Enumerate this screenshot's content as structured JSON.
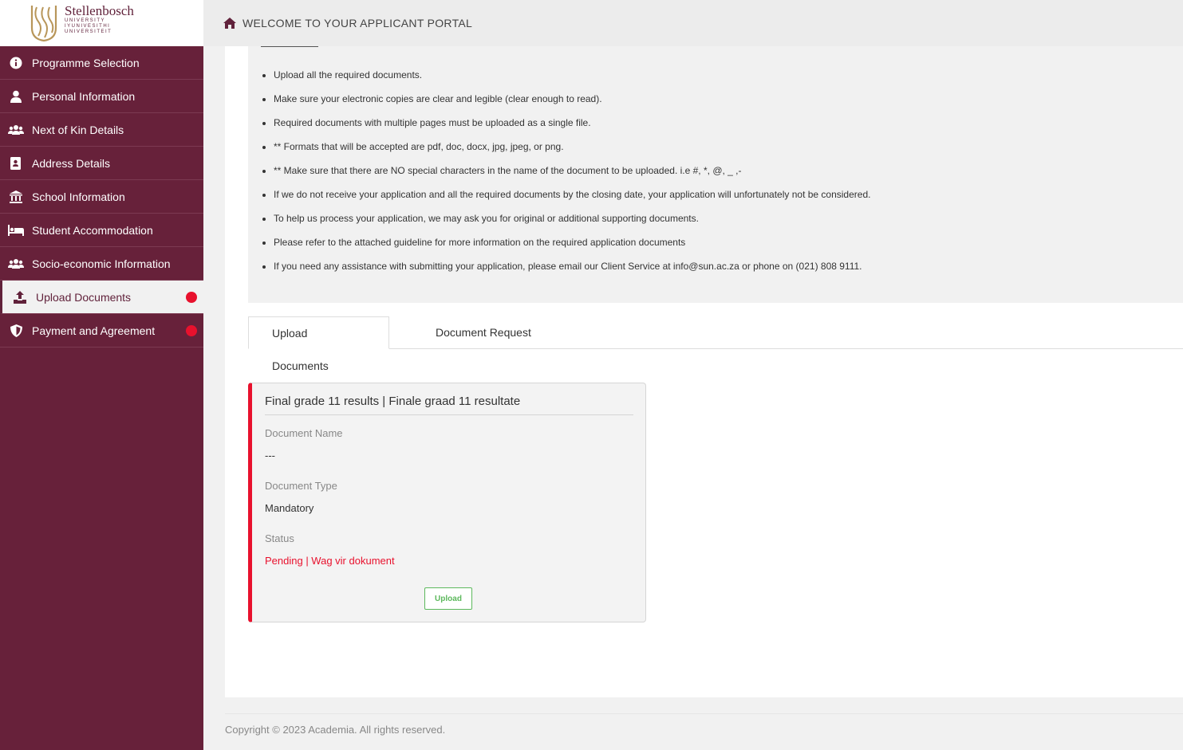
{
  "logo": {
    "name": "Stellenbosch",
    "sub1": "UNIVERSITY",
    "sub2": "IYUNIVESITHI",
    "sub3": "UNIVERSITEIT"
  },
  "header": {
    "title": "WELCOME TO YOUR APPLICANT PORTAL",
    "icon": "home-icon"
  },
  "sidebar": {
    "items": [
      {
        "label": "Programme Selection",
        "icon": "info-circle-icon"
      },
      {
        "label": "Personal Information",
        "icon": "user-icon"
      },
      {
        "label": "Next of Kin Details",
        "icon": "users-icon"
      },
      {
        "label": "Address Details",
        "icon": "address-book-icon"
      },
      {
        "label": "School Information",
        "icon": "university-icon"
      },
      {
        "label": "Student Accommodation",
        "icon": "bed-icon"
      },
      {
        "label": "Socio-economic Information",
        "icon": "users-icon"
      },
      {
        "label": "Upload Documents",
        "icon": "upload-icon",
        "active": true,
        "alert": true
      },
      {
        "label": "Payment and Agreement",
        "icon": "shield-icon",
        "alert": true
      }
    ]
  },
  "instructions": [
    "Upload all the required documents.",
    "Make sure your electronic copies are clear and legible (clear enough to read).",
    "Required documents with multiple pages must be uploaded as a single file.",
    "** Formats that will be accepted are pdf, doc, docx, jpg, jpeg, or png.",
    "** Make sure that there are NO special characters in the name of the document to be uploaded. i.e #, *, @, _ ,-",
    "If we do not receive your application and all the required documents by the closing date, your application will unfortunately not be considered.",
    "To help us process your application, we may ask you for original or additional supporting documents.",
    "Please refer to the attached guideline for more information on the required application documents",
    "If you need any assistance with submitting your application, please email our Client Service at info@sun.ac.za or phone on (021) 808 9111."
  ],
  "tabs": [
    {
      "label": "Upload Documents",
      "active": true
    },
    {
      "label": "Document Request"
    }
  ],
  "document_card": {
    "title": "Final grade 11 results | Finale graad 11 resultate",
    "name_label": "Document Name",
    "name_value": "---",
    "type_label": "Document Type",
    "type_value": "Mandatory",
    "status_label": "Status",
    "status_value": "Pending | Wag vir dokument",
    "upload_label": "Upload"
  },
  "footer": {
    "copyright": "Copyright © 2023 Academia. All rights reserved."
  },
  "colors": {
    "brand": "#67213a",
    "alert": "#e8112d",
    "success": "#5cb85c"
  }
}
